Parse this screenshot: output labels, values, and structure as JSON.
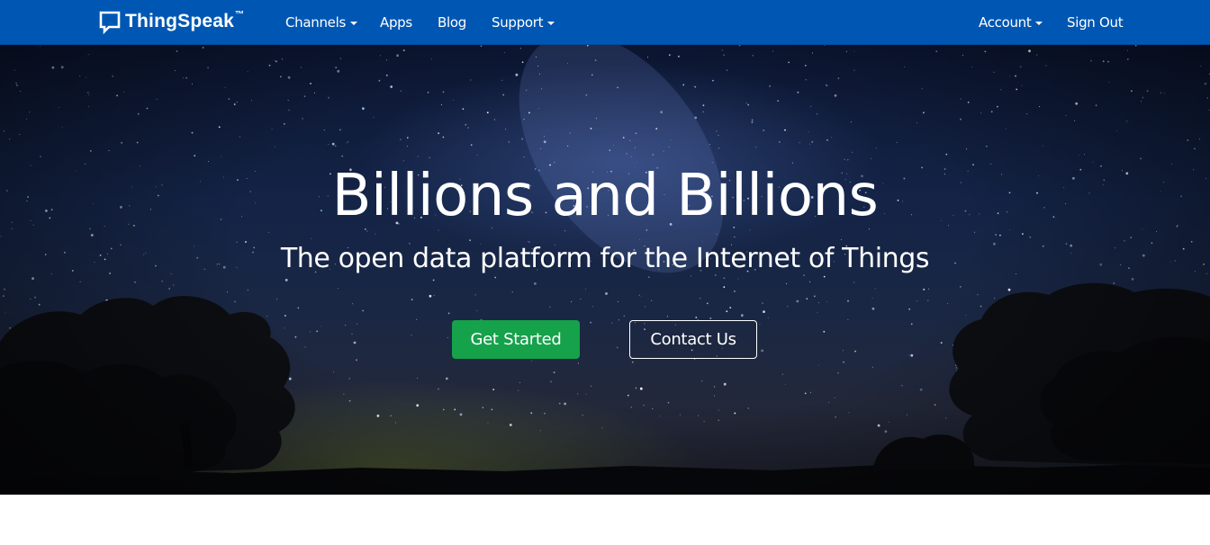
{
  "navbar": {
    "brand": "ThingSpeak",
    "brand_tm": "™",
    "items": [
      {
        "label": "Channels",
        "dropdown": true
      },
      {
        "label": "Apps",
        "dropdown": false
      },
      {
        "label": "Blog",
        "dropdown": false
      },
      {
        "label": "Support",
        "dropdown": true
      }
    ],
    "right_items": [
      {
        "label": "Account",
        "dropdown": true
      },
      {
        "label": "Sign Out",
        "dropdown": false
      }
    ],
    "background_color": "#0057b3"
  },
  "hero": {
    "headline": "Billions and Billions",
    "tagline": "The open data platform for the Internet of Things",
    "primary_button": "Get Started",
    "secondary_button": "Contact Us",
    "primary_button_color": "#16a14b",
    "background": "starry night sky with tree silhouettes"
  }
}
